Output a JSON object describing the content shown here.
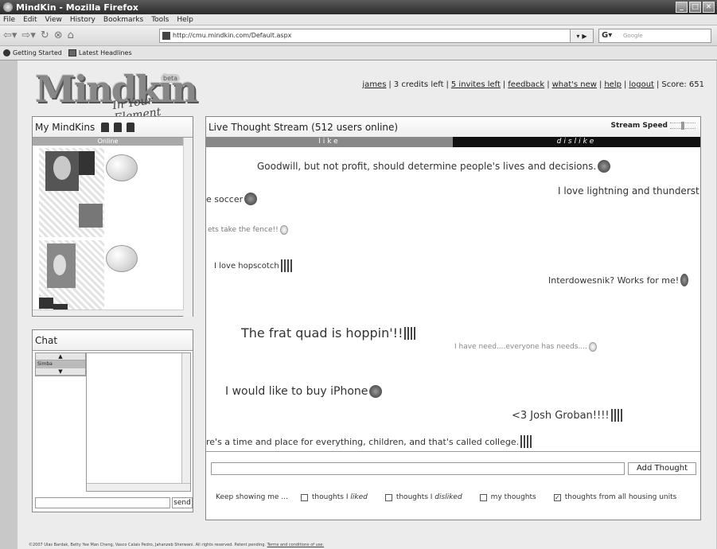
{
  "browser": {
    "title": "MindKin - Mozilla Firefox",
    "menu": [
      "File",
      "Edit",
      "View",
      "History",
      "Bookmarks",
      "Tools",
      "Help"
    ],
    "url": "http://cmu.mindkin.com/Default.aspx",
    "search_placeholder": "Google",
    "bookmarks": [
      "Getting Started",
      "Latest Headlines"
    ]
  },
  "logo": {
    "name": "Mindkin",
    "tagline": "In Your Element",
    "badge": "beta"
  },
  "topbar": {
    "user": "james",
    "credits": "3 credits left",
    "invites": "5 invites left",
    "feedback": "feedback",
    "whats_new": "what's new",
    "help": "help",
    "logout": "logout",
    "score": "Score: 651"
  },
  "mykins": {
    "title": "My MindKins",
    "status": "Online"
  },
  "chat": {
    "title": "Chat",
    "users": [
      "Simba"
    ],
    "send_label": "send"
  },
  "stream": {
    "title": "Live Thought Stream (512 users online)",
    "speed_label": "Stream Speed",
    "like_label": "like",
    "dislike_label": "dislike",
    "thoughts": [
      "Goodwill, but not profit, should determine people's lives and decisions.",
      "I love lightning and thunderst",
      "e soccer",
      "ets take the fence!!",
      "I love hopscotch",
      "Interdowesnik? Works for me!",
      "The frat quad is hoppin'!!",
      "I have need....everyone has needs....",
      "I would like to buy iPhone",
      "<3 Josh Groban!!!!",
      "re's a time and place for everything, children, and that's called college."
    ],
    "add_button": "Add Thought",
    "filter_label": "Keep showing me ...",
    "filters": [
      {
        "label_pre": "thoughts I ",
        "label_em": "liked",
        "checked": false
      },
      {
        "label_pre": "thoughts I ",
        "label_em": "disliked",
        "checked": false
      },
      {
        "label_pre": "my thoughts",
        "label_em": "",
        "checked": false
      },
      {
        "label_pre": "thoughts from all housing units",
        "label_em": "",
        "checked": true
      }
    ]
  },
  "footer": {
    "text": "©2007 Ulas Bardak, Betty Yee Man Cheng, Vasco Calais Pedro, Jahanzeb Sherwani. All rights reserved. Patent pending.",
    "terms": "Terms and conditions of use."
  }
}
